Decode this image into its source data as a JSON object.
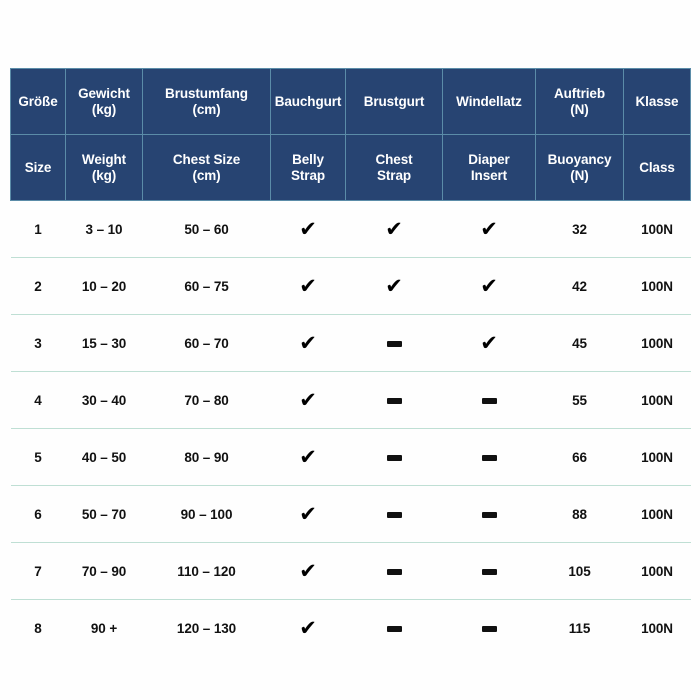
{
  "table": {
    "header_de": [
      "Größe",
      "Gewicht\n(kg)",
      "Brustumfang\n(cm)",
      "Bauchgurt",
      "Brustgurt",
      "Windellatz",
      "Auftrieb\n(N)",
      "Klasse"
    ],
    "header_en": [
      "Size",
      "Weight\n(kg)",
      "Chest Size\n(cm)",
      "Belly\nStrap",
      "Chest\nStrap",
      "Diaper\nInsert",
      "Buoyancy\n(N)",
      "Class"
    ],
    "header_de_lines": [
      [
        "Größe"
      ],
      [
        "Gewicht",
        "(kg)"
      ],
      [
        "Brustumfang",
        "(cm)"
      ],
      [
        "Bauchgurt"
      ],
      [
        "Brustgurt"
      ],
      [
        "Windellatz"
      ],
      [
        "Auftrieb",
        "(N)"
      ],
      [
        "Klasse"
      ]
    ],
    "header_en_lines": [
      [
        "Size"
      ],
      [
        "Weight",
        "(kg)"
      ],
      [
        "Chest Size",
        "(cm)"
      ],
      [
        "Belly",
        "Strap"
      ],
      [
        "Chest",
        "Strap"
      ],
      [
        "Diaper",
        "Insert"
      ],
      [
        "Buoyancy",
        "(N)"
      ],
      [
        "Class"
      ]
    ],
    "rows": [
      {
        "size": "1",
        "weight": "3 – 10",
        "chest": "50 – 60",
        "belly_strap": "check",
        "chest_strap": "check",
        "diaper_insert": "check",
        "buoyancy": "32",
        "class": "100N"
      },
      {
        "size": "2",
        "weight": "10 – 20",
        "chest": "60 – 75",
        "belly_strap": "check",
        "chest_strap": "check",
        "diaper_insert": "check",
        "buoyancy": "42",
        "class": "100N"
      },
      {
        "size": "3",
        "weight": "15 – 30",
        "chest": "60 – 70",
        "belly_strap": "check",
        "chest_strap": "dash",
        "diaper_insert": "check",
        "buoyancy": "45",
        "class": "100N"
      },
      {
        "size": "4",
        "weight": "30 – 40",
        "chest": "70 – 80",
        "belly_strap": "check",
        "chest_strap": "dash",
        "diaper_insert": "dash",
        "buoyancy": "55",
        "class": "100N"
      },
      {
        "size": "5",
        "weight": "40 – 50",
        "chest": "80 – 90",
        "belly_strap": "check",
        "chest_strap": "dash",
        "diaper_insert": "dash",
        "buoyancy": "66",
        "class": "100N"
      },
      {
        "size": "6",
        "weight": "50 – 70",
        "chest": "90 – 100",
        "belly_strap": "check",
        "chest_strap": "dash",
        "diaper_insert": "dash",
        "buoyancy": "88",
        "class": "100N"
      },
      {
        "size": "7",
        "weight": "70 – 90",
        "chest": "110 – 120",
        "belly_strap": "check",
        "chest_strap": "dash",
        "diaper_insert": "dash",
        "buoyancy": "105",
        "class": "100N"
      },
      {
        "size": "8",
        "weight": "90 +",
        "chest": "120 – 130",
        "belly_strap": "check",
        "chest_strap": "dash",
        "diaper_insert": "dash",
        "buoyancy": "115",
        "class": "100N"
      }
    ],
    "glyphs": {
      "check": "✔",
      "dash": ""
    },
    "colors": {
      "header_background": "#274472",
      "header_text": "#ffffff",
      "header_gridline": "#5b8ca8",
      "row_separator": "#bfdfd4",
      "body_text": "#111111",
      "page_background": "#fefefe"
    }
  }
}
